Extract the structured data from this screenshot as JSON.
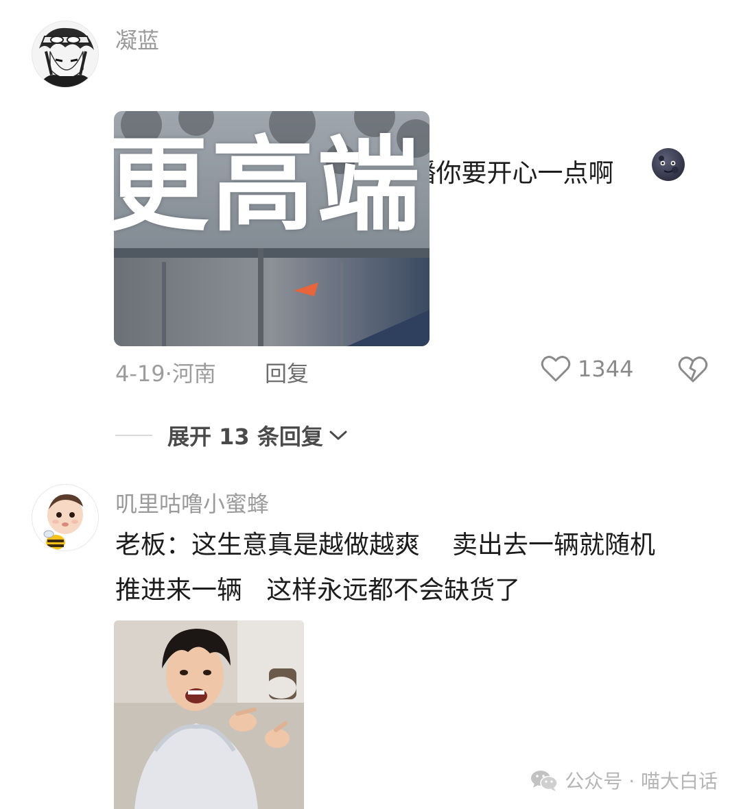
{
  "comment1": {
    "username": "凝蓝",
    "avatar_icon": "anime-avatar-icon",
    "text": "推进去的车更高端了，主播你要开心一点啊",
    "emoji_icon": "new-moon-face-emoji",
    "image": {
      "overlay_text": "更高端"
    },
    "date": "4-19",
    "location": "河南",
    "reply_label": "回复",
    "like_count": "1344",
    "like_icon": "heart-outline-icon",
    "dislike_icon": "broken-heart-icon"
  },
  "expand_replies": {
    "label": "展开 13 条回复",
    "icon": "chevron-down-icon"
  },
  "comment2": {
    "username": "叽里咕噜小蜜蜂",
    "avatar_icon": "baby-bee-avatar-icon",
    "text_line1": "老板：这生意真是越做越爽    卖出去一辆就随机",
    "text_line2": "推进来一辆   这样永远都不会缺货了"
  },
  "watermark": {
    "icon": "wechat-icon",
    "text": "公众号 · 喵大白话"
  }
}
